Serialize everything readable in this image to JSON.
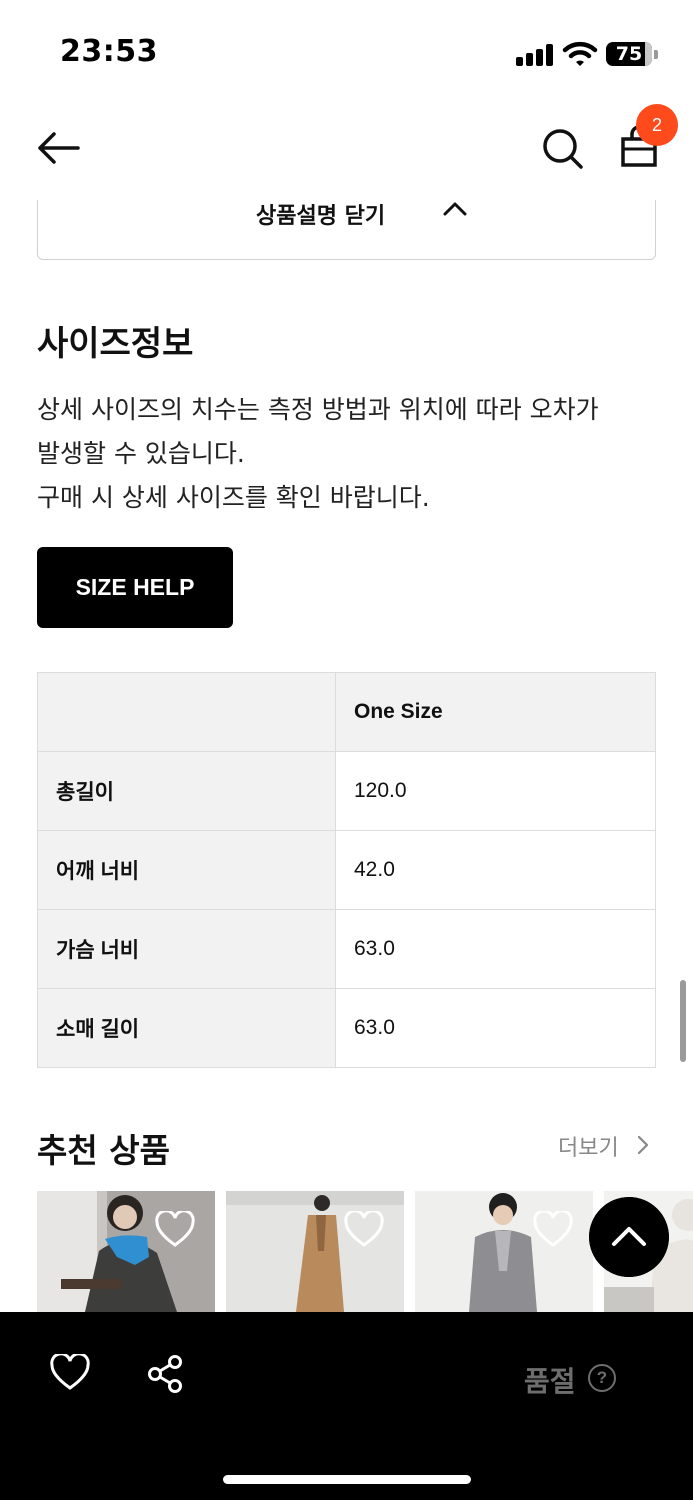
{
  "status_bar": {
    "time": "23:53",
    "battery": "75"
  },
  "nav": {
    "cart_count": "2"
  },
  "description_toggle": {
    "label": "상품설명 닫기"
  },
  "size_info": {
    "title": "사이즈정보",
    "description_lines": [
      "상세 사이즈의 치수는 측정 방법과 위치에 따라 오차가",
      "발생할 수 있습니다.",
      "구매 시 상세 사이즈를 확인 바랍니다."
    ],
    "size_help_label": "SIZE HELP",
    "table": {
      "header": [
        "",
        "One Size"
      ],
      "rows": [
        {
          "label": "총길이",
          "value": "120.0"
        },
        {
          "label": "어깨 너비",
          "value": "42.0"
        },
        {
          "label": "가슴 너비",
          "value": "63.0"
        },
        {
          "label": "소매 길이",
          "value": "63.0"
        }
      ]
    }
  },
  "recommended": {
    "title": "추천 상품",
    "more_label": "더보기"
  },
  "bottom_bar": {
    "status_label": "품절",
    "help_glyph": "?"
  },
  "colors": {
    "badge": "#ff4a1c",
    "bottom_bar": "#000000",
    "button": "#000000"
  }
}
